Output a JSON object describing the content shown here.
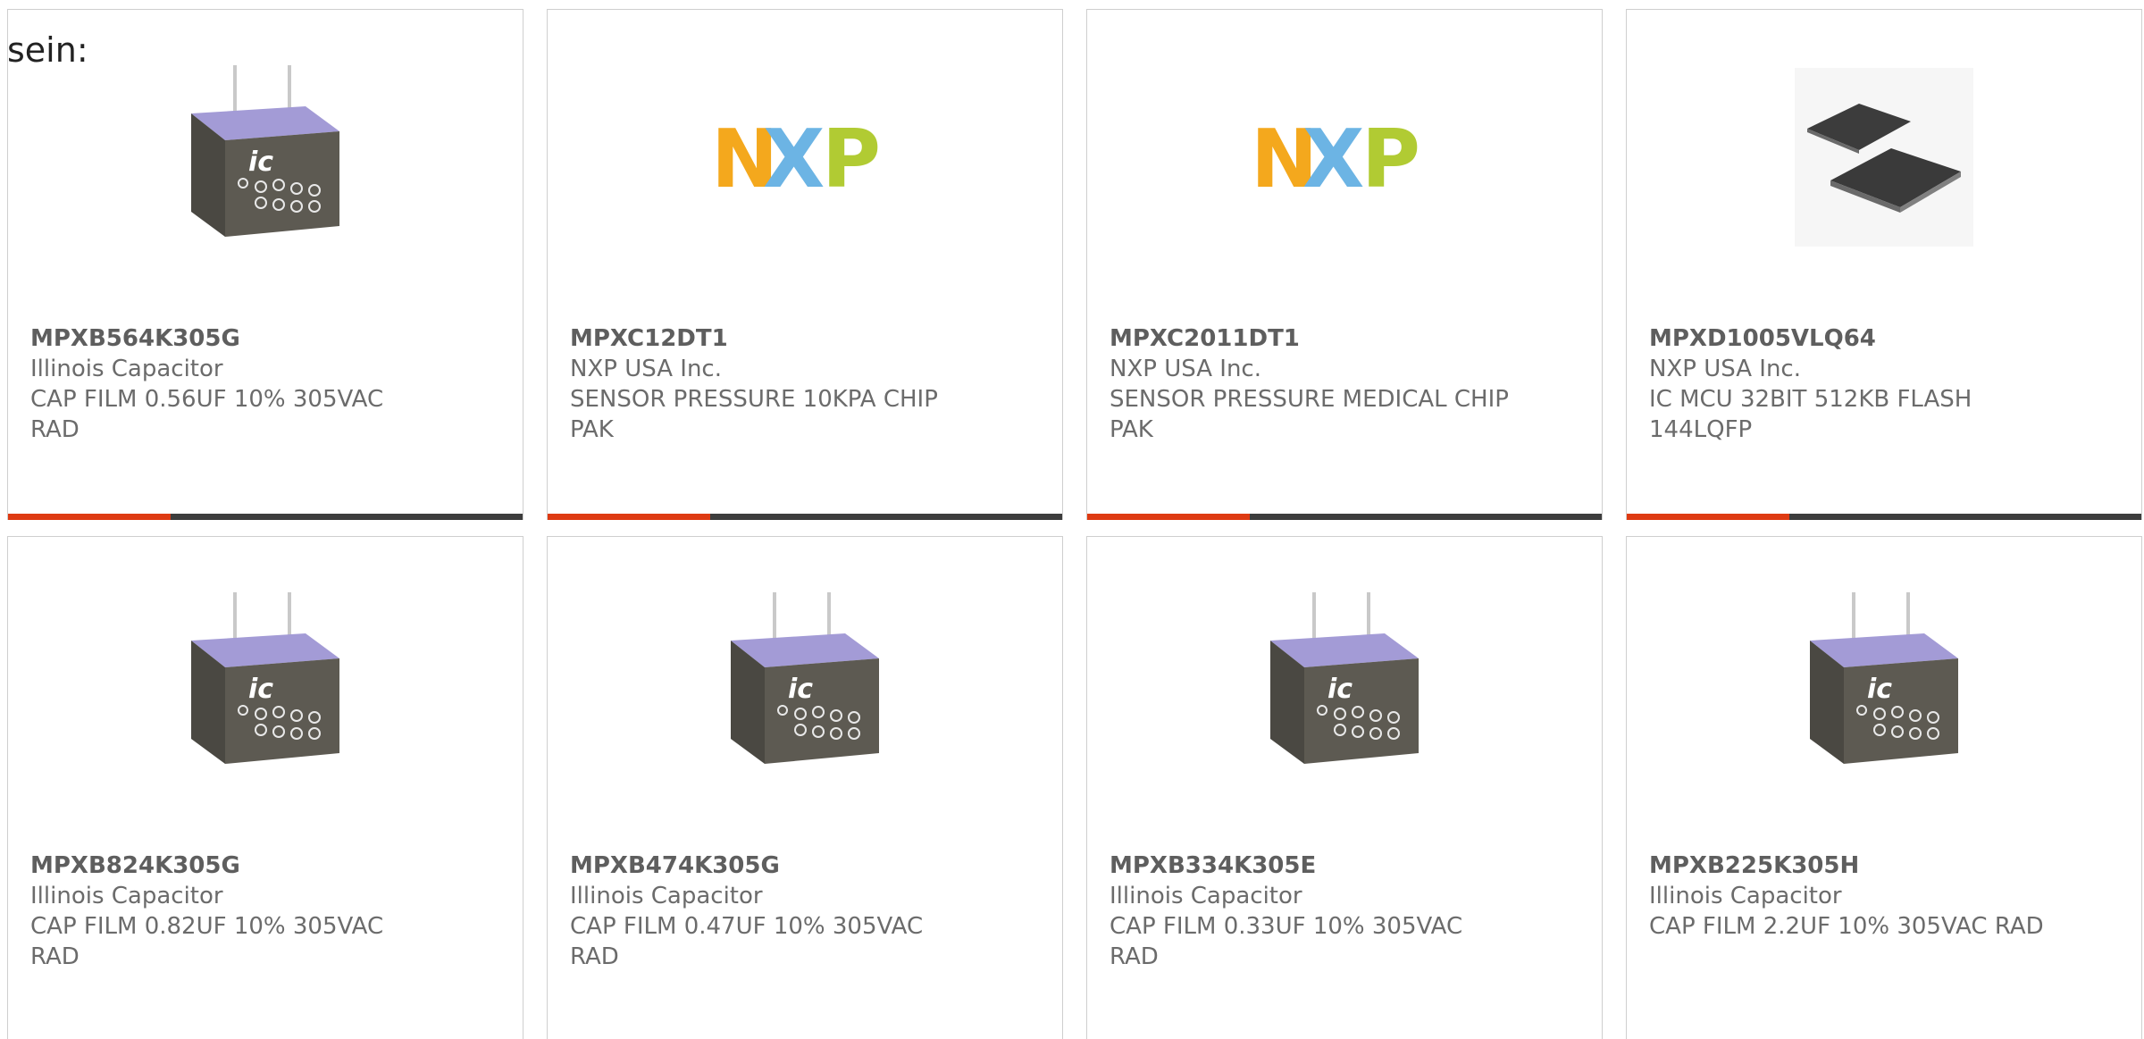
{
  "intro_text": "sein:",
  "colors": {
    "accent_bar": "#de3a12",
    "dark_bar": "#3d3d3d",
    "nxp_orange": "#f4a81d",
    "nxp_blue": "#6cb4e4",
    "nxp_green": "#b1cb33"
  },
  "products": [
    {
      "part_number": "MPXB564K305G",
      "manufacturer": "Illinois Capacitor",
      "description": "CAP FILM 0.56UF 10% 305VAC RAD",
      "image": "film-capacitor-icon"
    },
    {
      "part_number": "MPXC12DT1",
      "manufacturer": "NXP USA Inc.",
      "description": "SENSOR PRESSURE 10KPA CHIP PAK",
      "image": "nxp-logo",
      "logo_letters": [
        "N",
        "X",
        "P"
      ]
    },
    {
      "part_number": "MPXC2011DT1",
      "manufacturer": "NXP USA Inc.",
      "description": "SENSOR PRESSURE MEDICAL CHIP PAK",
      "image": "nxp-logo",
      "logo_letters": [
        "N",
        "X",
        "P"
      ]
    },
    {
      "part_number": "MPXD1005VLQ64",
      "manufacturer": "NXP USA Inc.",
      "description": "IC MCU 32BIT 512KB FLASH 144LQFP",
      "image": "lqfp-chip-icon"
    },
    {
      "part_number": "MPXB824K305G",
      "manufacturer": "Illinois Capacitor",
      "description": "CAP FILM 0.82UF 10% 305VAC RAD",
      "image": "film-capacitor-icon"
    },
    {
      "part_number": "MPXB474K305G",
      "manufacturer": "Illinois Capacitor",
      "description": "CAP FILM 0.47UF 10% 305VAC RAD",
      "image": "film-capacitor-icon"
    },
    {
      "part_number": "MPXB334K305E",
      "manufacturer": "Illinois Capacitor",
      "description": "CAP FILM 0.33UF 10% 305VAC RAD",
      "image": "film-capacitor-icon"
    },
    {
      "part_number": "MPXB225K305H",
      "manufacturer": "Illinois Capacitor",
      "description": "CAP FILM 2.2UF 10% 305VAC RAD",
      "image": "film-capacitor-icon"
    }
  ]
}
